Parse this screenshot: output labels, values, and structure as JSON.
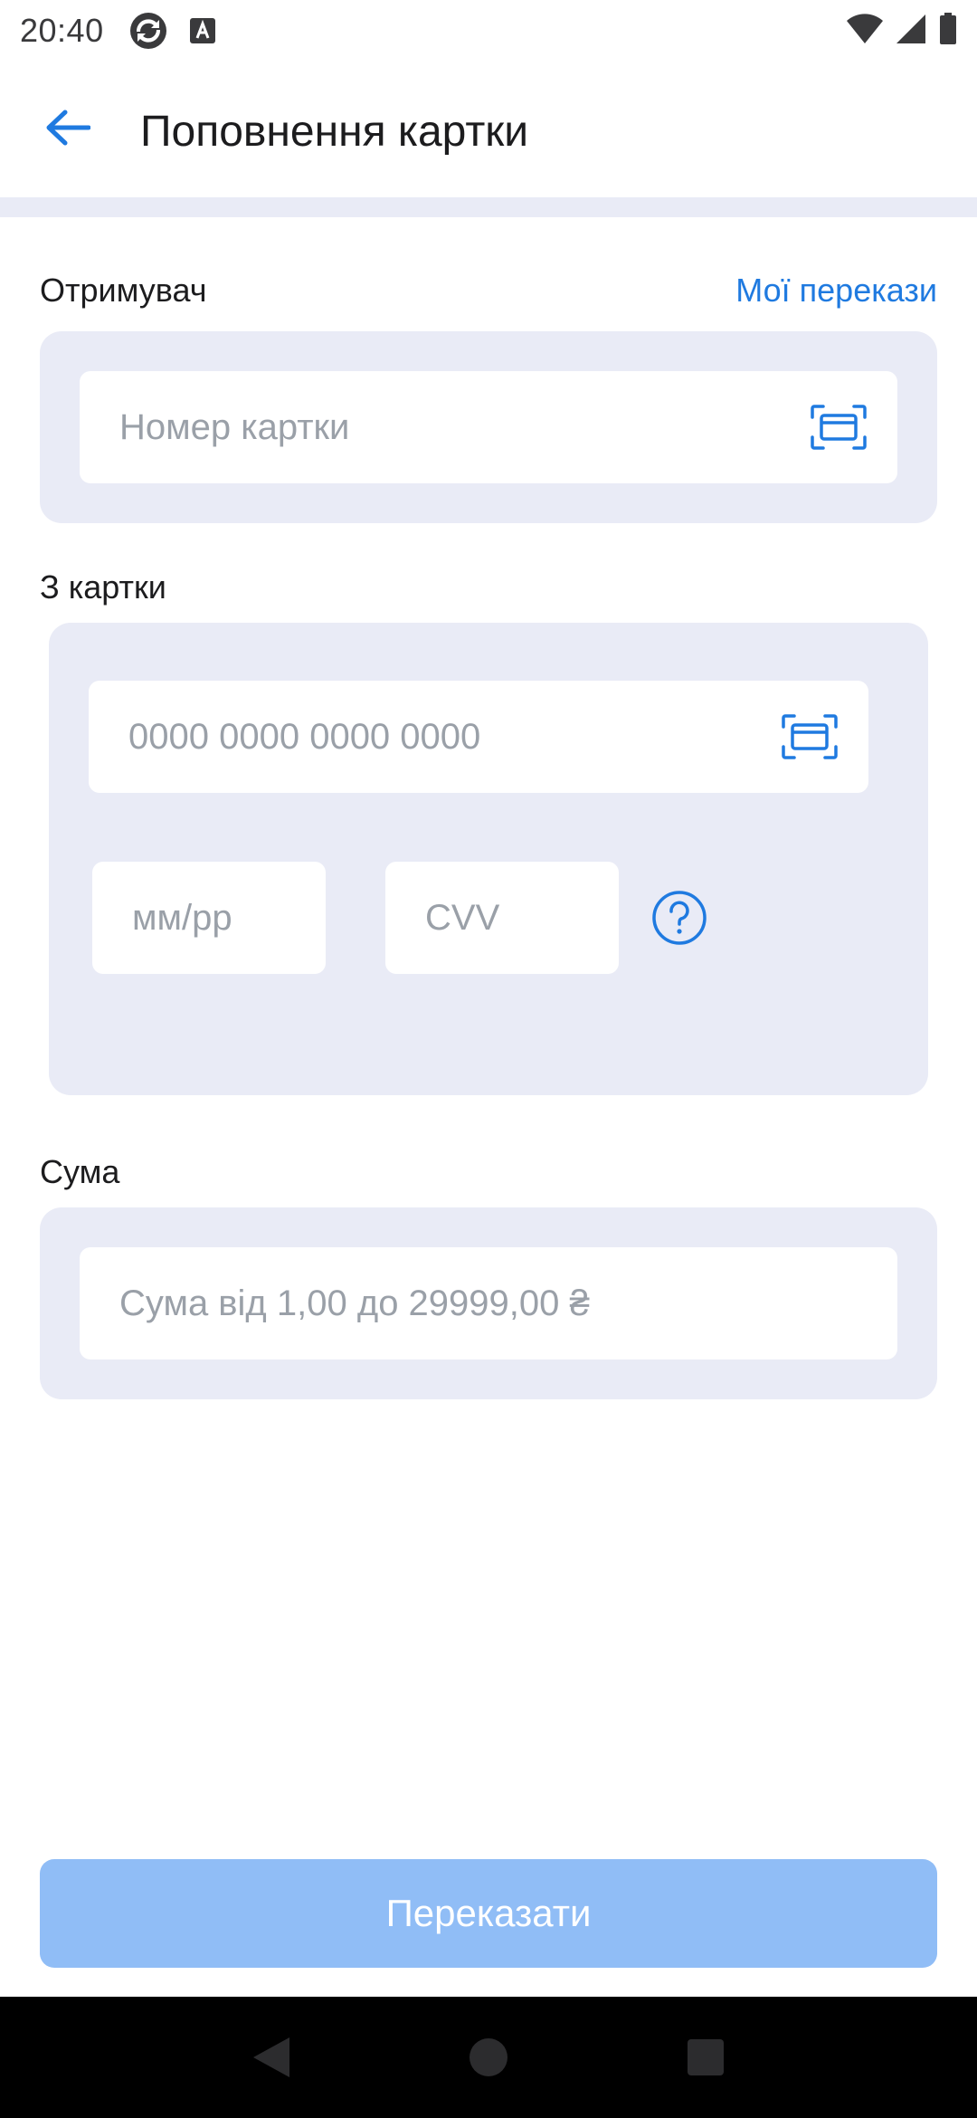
{
  "status_bar": {
    "time": "20:40",
    "icons": [
      "sync-icon",
      "a-badge-icon",
      "wifi-icon",
      "signal-icon",
      "battery-icon"
    ]
  },
  "app_bar": {
    "title": "Поповнення картки",
    "back_icon": "arrow-left-icon"
  },
  "recipient": {
    "label": "Отримувач",
    "link": "Мої перекази",
    "card_placeholder": "Номер картки",
    "scan_icon": "card-scan-icon"
  },
  "from_card": {
    "label": "З картки",
    "card_placeholder": "0000 0000 0000 0000",
    "expiry_placeholder": "мм/рр",
    "cvv_placeholder": "CVV",
    "help_icon": "question-circle-icon"
  },
  "amount": {
    "label": "Сума",
    "placeholder": "Сума від 1,00 до 29999,00 ₴"
  },
  "submit": {
    "label": "Переказати"
  },
  "colors": {
    "accent": "#1f7ae0",
    "panel": "#e9ebf6",
    "button_disabled": "#90bdf6",
    "placeholder": "#9aa0a8"
  }
}
